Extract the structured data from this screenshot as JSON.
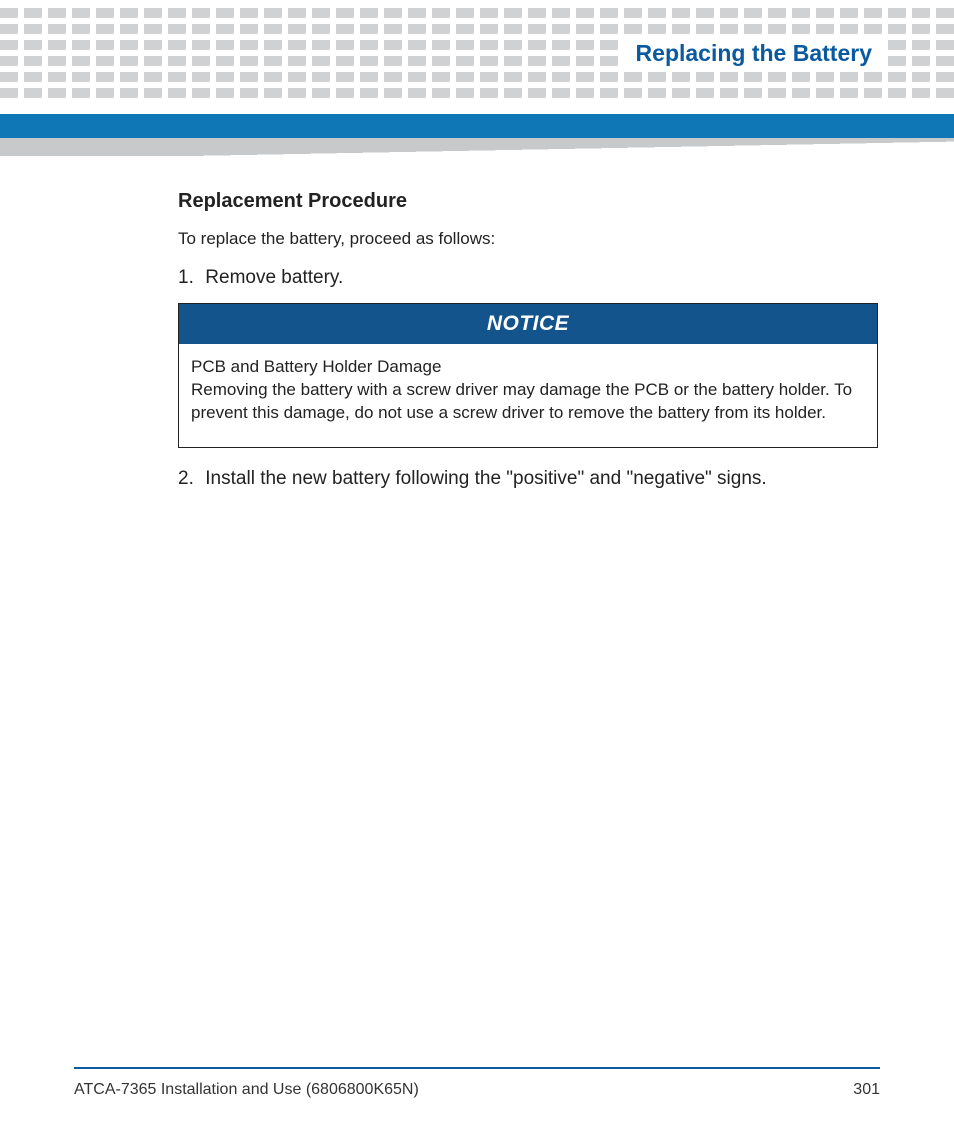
{
  "header": {
    "chapter_title": "Replacing the Battery"
  },
  "content": {
    "subhead": "Replacement Procedure",
    "lead": "To replace the battery, proceed as follows:",
    "steps": {
      "s1": {
        "num": "1.",
        "text": "Remove battery."
      },
      "s2": {
        "num": "2.",
        "text": "Install the new battery following the \"positive\" and \"negative\" signs."
      }
    },
    "notice": {
      "label": "NOTICE",
      "title": "PCB and Battery Holder Damage",
      "body": "Removing the battery with a screw driver may damage the PCB or the battery holder. To prevent this damage, do not use a screw driver to remove the battery from its holder."
    }
  },
  "footer": {
    "doc": "ATCA-7365 Installation and Use (6806800K65N)",
    "page": "301"
  }
}
